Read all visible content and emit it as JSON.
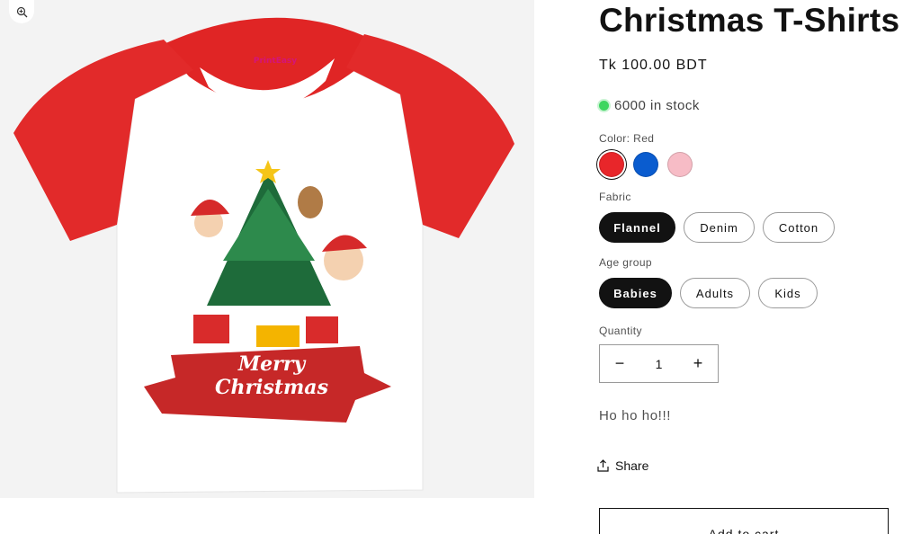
{
  "media": {
    "brand": "PrintEasy",
    "banner": "Merry Christmas",
    "zoom_icon": "zoom-in-icon"
  },
  "product": {
    "title": "Christmas T-Shirts",
    "price": "Tk 100.00 BDT",
    "stock": "6000 in stock",
    "stock_color": "#3ed660",
    "description": "Ho ho ho!!!"
  },
  "options": {
    "color_label": "Color: Red",
    "colors": [
      {
        "name": "Red",
        "hex": "#e8262a"
      },
      {
        "name": "Blue",
        "hex": "#0a5ccf"
      },
      {
        "name": "Pink",
        "hex": "#f7bcc6"
      }
    ],
    "fabric_label": "Fabric",
    "fabrics": [
      "Flannel",
      "Denim",
      "Cotton"
    ],
    "age_label": "Age group",
    "ages": [
      "Babies",
      "Adults",
      "Kids"
    ]
  },
  "quantity": {
    "label": "Quantity",
    "value": "1",
    "minus": "−",
    "plus": "+"
  },
  "actions": {
    "share": "Share",
    "add_to_cart": "Add to cart"
  }
}
